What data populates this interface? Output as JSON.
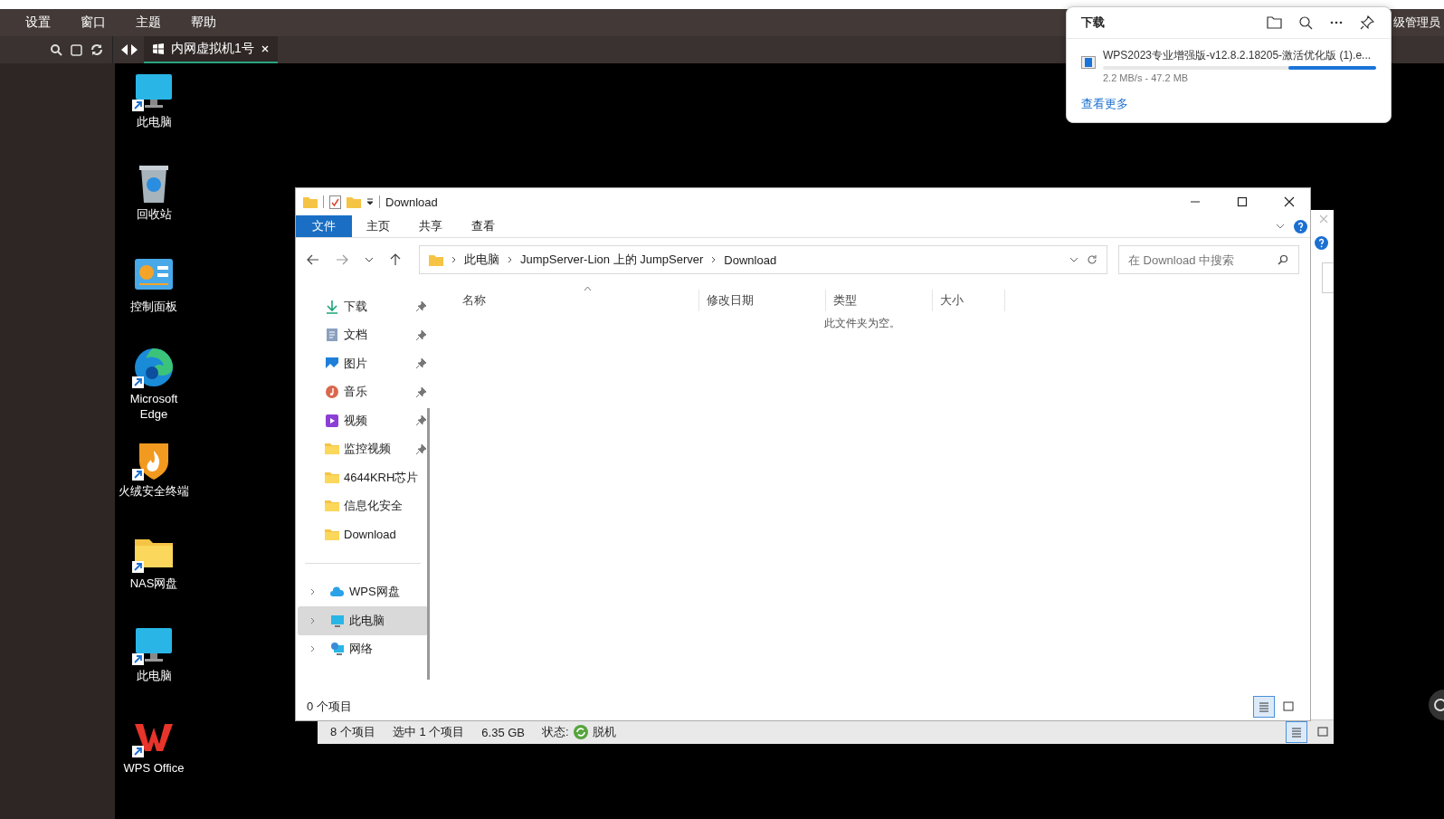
{
  "menu": [
    {
      "label": "设置"
    },
    {
      "label": "窗口"
    },
    {
      "label": "主题"
    },
    {
      "label": "帮助"
    }
  ],
  "tabs": [
    {
      "label": "内网虚拟机1号",
      "selected": true
    }
  ],
  "user_label": "级管理员",
  "desktop_icons": [
    {
      "label": "此电脑",
      "kind": "monitor",
      "shortcut": true
    },
    {
      "label": "回收站",
      "kind": "recycle",
      "shortcut": false
    },
    {
      "label": "控制面板",
      "kind": "control",
      "shortcut": false
    },
    {
      "label": "Microsoft Edge",
      "kind": "edge",
      "shortcut": true
    },
    {
      "label": "火绒安全终端",
      "kind": "shield",
      "shortcut": true
    },
    {
      "label": "NAS网盘",
      "kind": "folder",
      "shortcut": true
    },
    {
      "label": "此电脑",
      "kind": "monitor",
      "shortcut": true
    },
    {
      "label": "WPS Office",
      "kind": "wps",
      "shortcut": true
    }
  ],
  "download_panel": {
    "title": "下载",
    "item": {
      "name": "WPS2023专业增强版-v12.8.2.18205-激活优化版 (1).e...",
      "level": 0.32,
      "info": "2.2 MB/s - 47.2 MB"
    },
    "more_link": "查看更多"
  },
  "back_window": {
    "status": [
      "8 个项目",
      "选中 1 个项目",
      "6.35 GB"
    ],
    "state_label": "状态:",
    "state": "脱机"
  },
  "explorer": {
    "title": "Download",
    "ribbon_tabs": [
      {
        "label": "文件",
        "selected": true
      },
      {
        "label": "主页",
        "selected": false
      },
      {
        "label": "共享",
        "selected": false
      },
      {
        "label": "查看",
        "selected": false
      }
    ],
    "breadcrumb": [
      "此电脑",
      "JumpServer-Lion 上的 JumpServer",
      "Download"
    ],
    "search": {
      "placeholder": "在 Download 中搜索"
    },
    "quick_access": [
      {
        "label": "下载",
        "kind": "download",
        "pinned": true
      },
      {
        "label": "文档",
        "kind": "doc",
        "pinned": true
      },
      {
        "label": "图片",
        "kind": "picture",
        "pinned": true
      },
      {
        "label": "音乐",
        "kind": "music",
        "pinned": true
      },
      {
        "label": "视频",
        "kind": "video",
        "pinned": true
      },
      {
        "label": "监控视频",
        "kind": "folder",
        "pinned": true
      },
      {
        "label": "4644KRH芯片",
        "kind": "folder",
        "pinned": false
      },
      {
        "label": "信息化安全",
        "kind": "folder",
        "pinned": false
      },
      {
        "label": "Download",
        "kind": "folder",
        "pinned": false
      }
    ],
    "locations": [
      {
        "label": "WPS网盘",
        "kind": "cloud",
        "selected": false
      },
      {
        "label": "此电脑",
        "kind": "pc",
        "selected": true
      },
      {
        "label": "网络",
        "kind": "network",
        "selected": false
      }
    ],
    "columns": [
      "名称",
      "修改日期",
      "类型",
      "大小"
    ],
    "empty_message": "此文件夹为空。",
    "status": "0 个项目"
  }
}
